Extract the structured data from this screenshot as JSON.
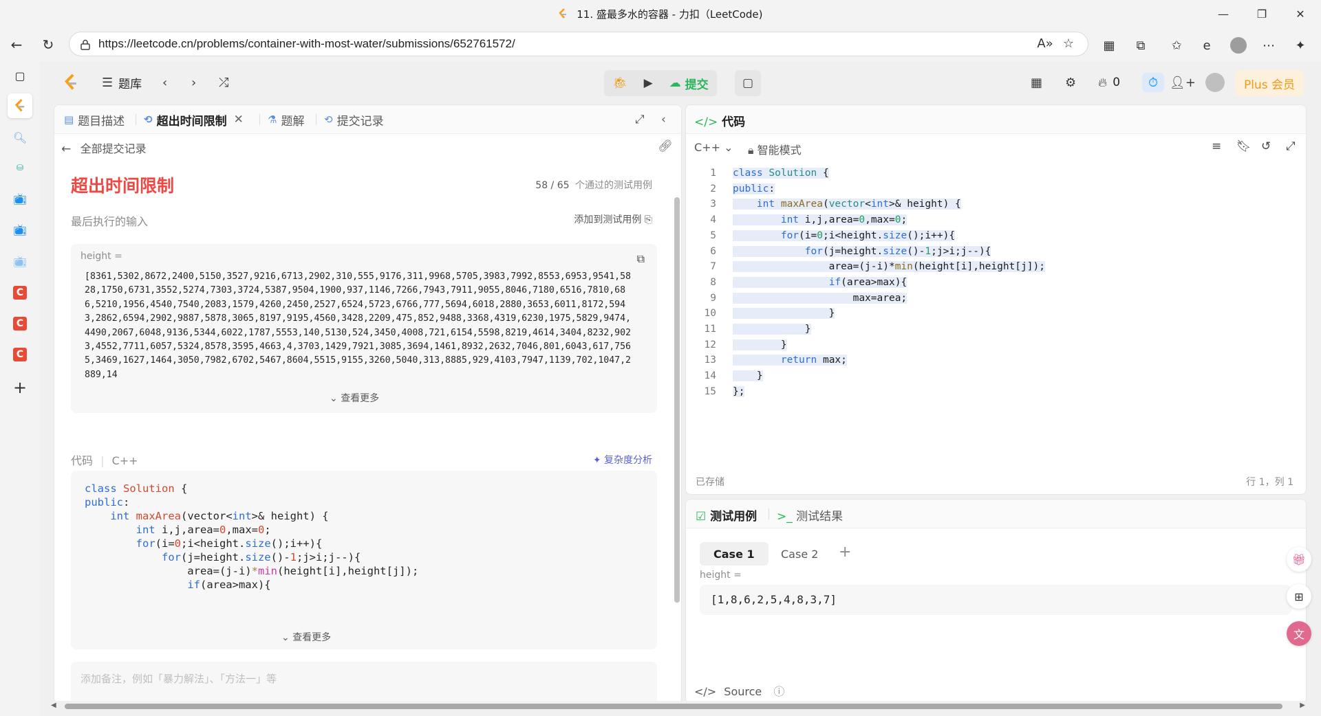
{
  "browser": {
    "tab_title": "11. 盛最多水的容器 - 力扣（LeetCode)",
    "url": "https://leetcode.cn/problems/container-with-most-water/submissions/652761572/"
  },
  "header": {
    "problem_list_label": "题库",
    "submit_label": "提交",
    "streak_count": "0",
    "plus_label": "Plus 会员"
  },
  "left_tabs": [
    {
      "label": "题目描述"
    },
    {
      "label": "超出时间限制"
    },
    {
      "label": "题解"
    },
    {
      "label": "提交记录"
    }
  ],
  "submission": {
    "back_label": "全部提交记录",
    "status": "超出时间限制",
    "passed": "58 / 65",
    "passed_suffix": "个通过的测试用例",
    "last_input_label": "最后执行的输入",
    "add_to_testcase": "添加到测试用例",
    "var_name": "height =",
    "var_value": "[8361,5302,8672,2400,5150,3527,9216,6713,2902,310,555,9176,311,9968,5705,3983,7992,8553,6953,9541,5828,1750,6731,3552,5274,7303,3724,5387,9504,1900,937,1146,7266,7943,7911,9055,8046,7180,6516,7810,686,5210,1956,4540,7540,2083,1579,4260,2450,2527,6524,5723,6766,777,5694,6018,2880,3653,6011,8172,5943,2862,6594,2902,9887,5878,3065,8197,9195,4560,3428,2209,475,852,9488,3368,4319,6230,1975,5829,9474,4490,2067,6048,9136,5344,6022,1787,5553,140,5130,524,3450,4008,721,6154,5598,8219,4614,3404,8232,9023,4552,7711,6057,5324,8578,3595,4663,4,3703,1429,7921,3085,3694,1461,8932,2632,7046,801,6043,617,7565,3469,1627,1464,3050,7982,6702,5467,8604,5515,9155,3260,5040,313,8885,929,4103,7947,1139,702,1047,2889,14",
    "see_more": "查看更多",
    "code_label": "代码",
    "code_lang": "C++",
    "complexity_label": "复杂度分析",
    "note_placeholder": "添加备注，例如「暴力解法」、「方法一」等"
  },
  "editor": {
    "title": "代码",
    "lang": "C++",
    "mode": "智能模式",
    "saved": "已存储",
    "cursor": "行 1，列 1",
    "line_numbers": [
      "1",
      "2",
      "3",
      "4",
      "5",
      "6",
      "7",
      "8",
      "9",
      "10",
      "11",
      "12",
      "13",
      "14",
      "15"
    ]
  },
  "testcase": {
    "tab1": "测试用例",
    "tab2": "测试结果",
    "cases": [
      "Case 1",
      "Case 2"
    ],
    "var_name": "height =",
    "var_value": "[1,8,6,2,5,4,8,3,7]",
    "source_label": "Source"
  },
  "colors": {
    "error_red": "#ef4743",
    "accept_green": "#2db55d",
    "plus_orange": "#ed9b17"
  }
}
